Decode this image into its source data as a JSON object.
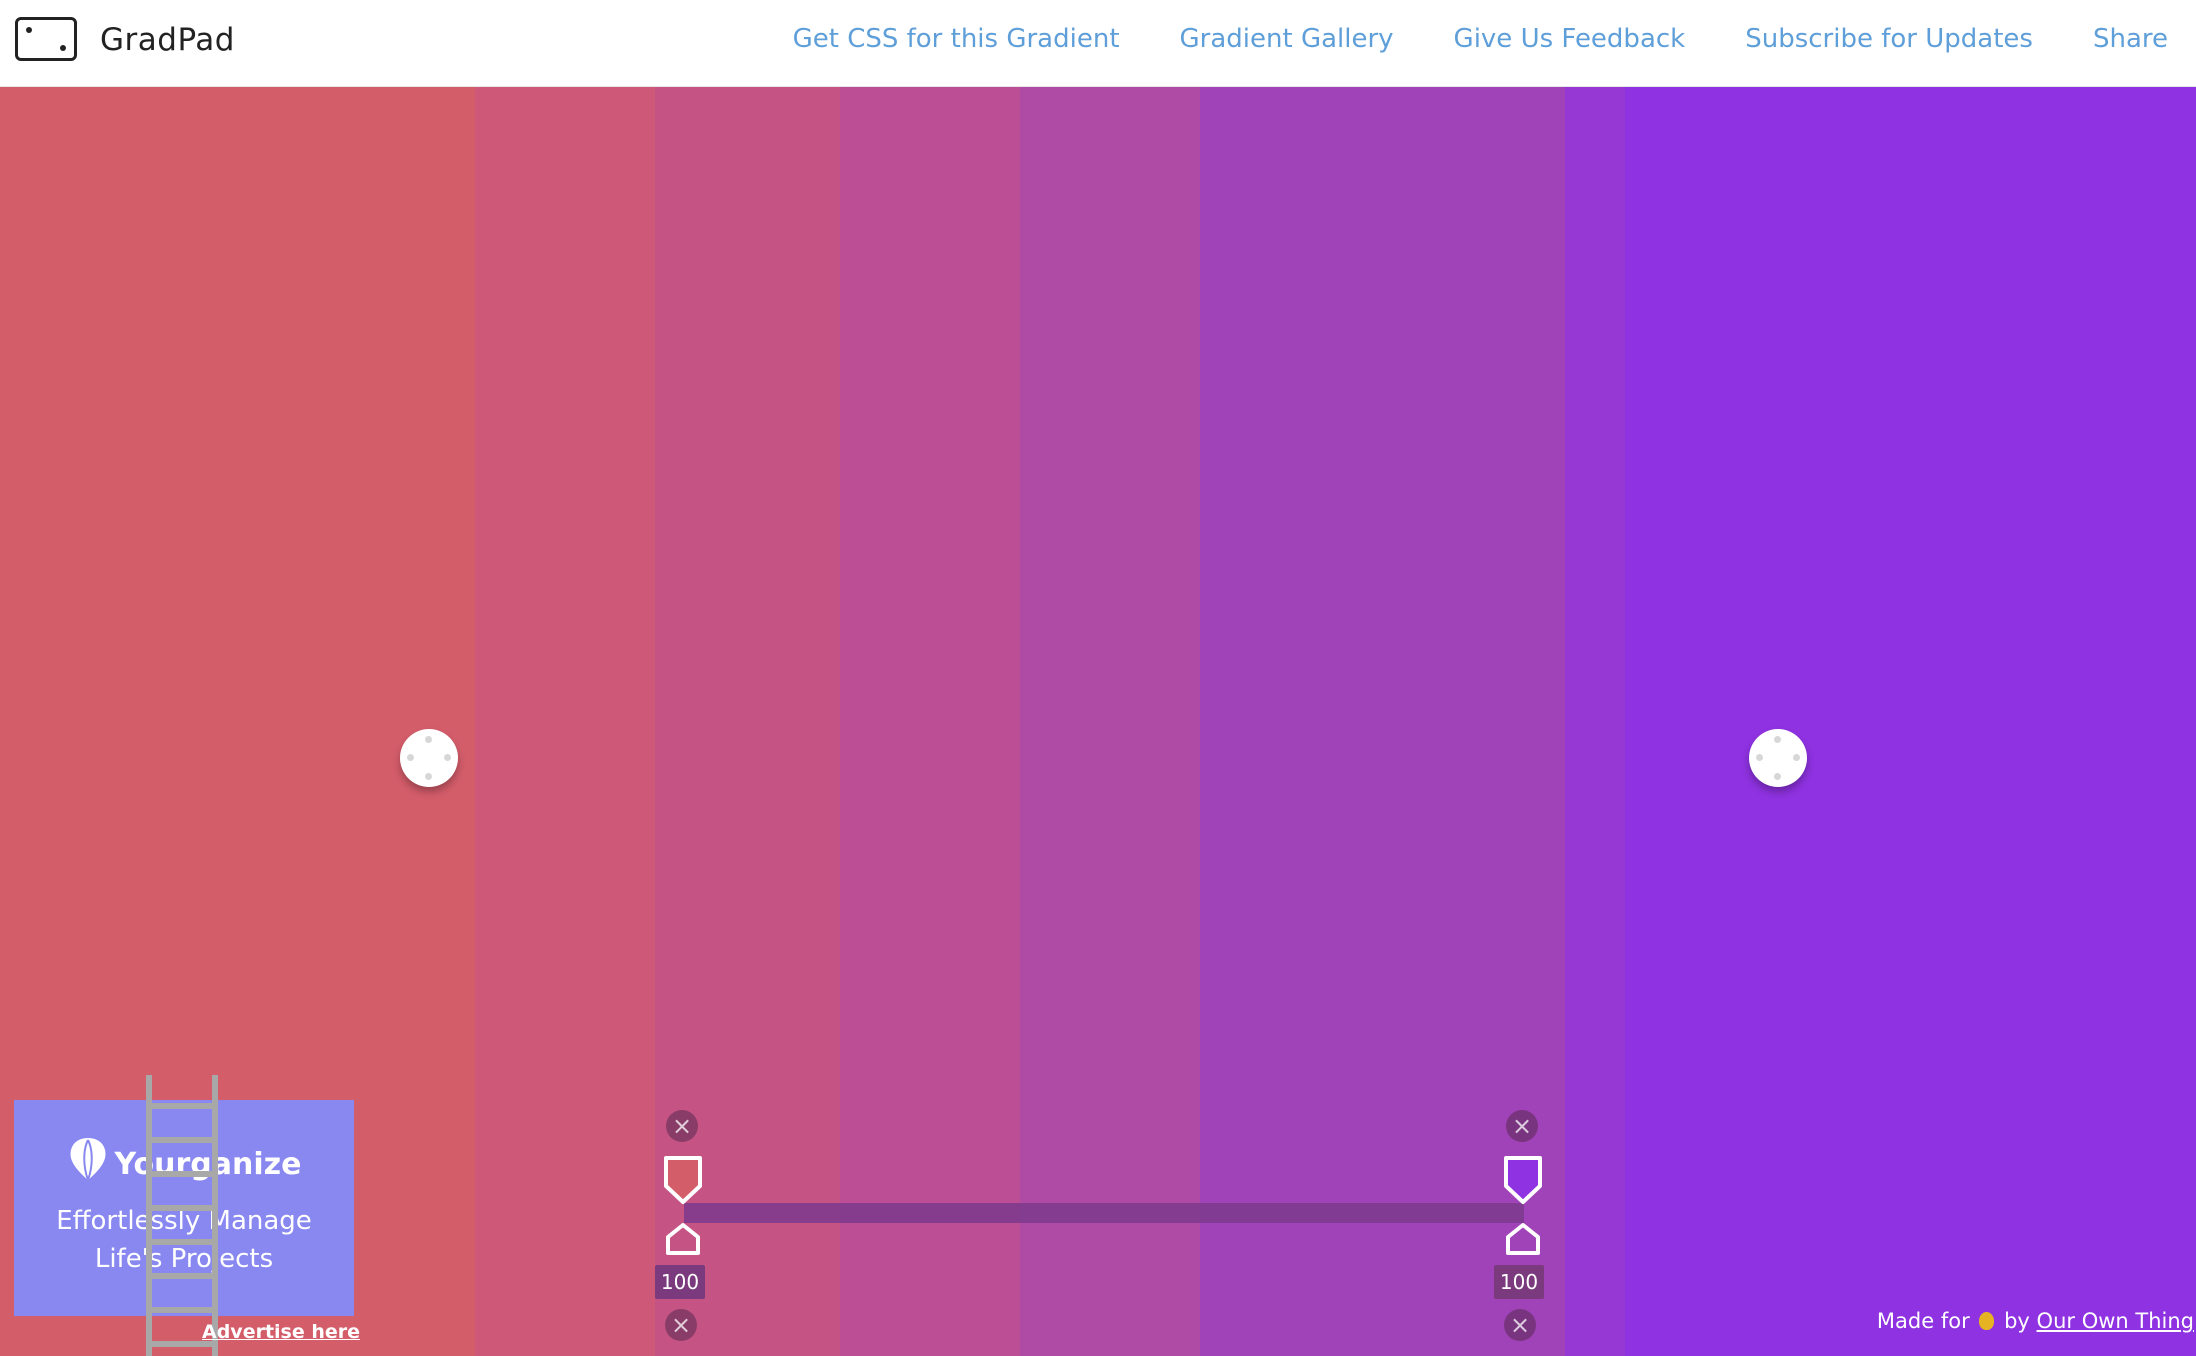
{
  "header": {
    "brand": "GradPad",
    "nav": [
      {
        "label": "Get CSS for this Gradient"
      },
      {
        "label": "Gradient Gallery"
      },
      {
        "label": "Give Us Feedback"
      },
      {
        "label": "Subscribe for Updates"
      },
      {
        "label": "Share"
      }
    ]
  },
  "gradient": {
    "bands": [
      "#d45d6a",
      "#cd5878",
      "#c55485",
      "#bb4e95",
      "#b04ba5",
      "#a143b8",
      "#9638d4",
      "#8f32e1"
    ],
    "stops": [
      {
        "value": "100"
      },
      {
        "value": "100"
      }
    ]
  },
  "ad": {
    "brand": "Yourganize",
    "tagline_line1": "Effortlessly Manage",
    "tagline_line2": "Life's Projects",
    "advertise": "Advertise here"
  },
  "footer": {
    "made_for": "Made for",
    "by": "by",
    "link": "Our Own Thing"
  },
  "colors": {
    "nav_link": "#5f9fd9",
    "track": "#7b3a8c",
    "ad_bg": "#8888f0"
  }
}
